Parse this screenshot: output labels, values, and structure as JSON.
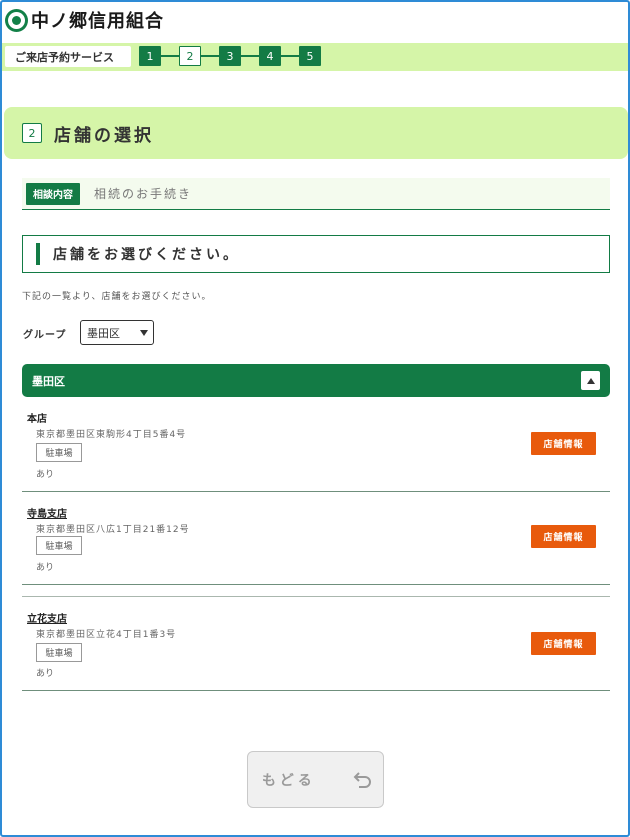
{
  "header": {
    "logo_text": "中ノ郷信用組合"
  },
  "stepper": {
    "service_label": "ご来店予約サービス",
    "steps": [
      "1",
      "2",
      "3",
      "4",
      "5"
    ],
    "current_step": "2"
  },
  "page": {
    "step_number": "2",
    "title": "店舗の選択"
  },
  "consultation": {
    "badge": "相談内容",
    "value": "相続のお手続き"
  },
  "section": {
    "heading": "店舗をお選びください。",
    "instruction": "下記の一覧より、店舗をお選びください。"
  },
  "group": {
    "label": "グループ",
    "selected": "墨田区"
  },
  "area": {
    "name": "墨田区"
  },
  "branches": [
    {
      "name": "本店",
      "address": "東京都墨田区東駒形4丁目5番4号",
      "parking_label": "駐車場",
      "parking_value": "あり",
      "button": "店舗情報"
    },
    {
      "name": "寺島支店",
      "address": "東京都墨田区八広1丁目21番12号",
      "parking_label": "駐車場",
      "parking_value": "あり",
      "button": "店舗情報"
    },
    {
      "name": "立花支店",
      "address": "東京都墨田区立花4丁目1番3号",
      "parking_label": "駐車場",
      "parking_value": "あり",
      "button": "店舗情報"
    }
  ],
  "footer": {
    "back_label": "もどる"
  },
  "colors": {
    "brand_green": "#137b45",
    "light_green": "#d5f5a8",
    "accent_orange": "#e85a0c"
  }
}
